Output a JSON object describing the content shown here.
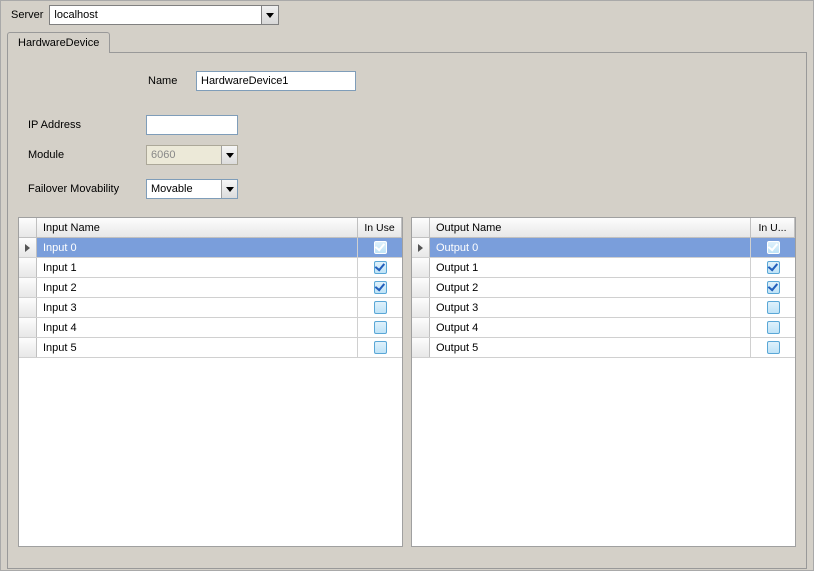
{
  "server": {
    "label": "Server",
    "value": "localhost"
  },
  "tab": {
    "label": "HardwareDevice"
  },
  "form": {
    "name_label": "Name",
    "name_value": "HardwareDevice1",
    "ip_label": "IP Address",
    "ip_value": "",
    "module_label": "Module",
    "module_value": "6060",
    "failover_label": "Failover Movability",
    "failover_value": "Movable"
  },
  "inputs": {
    "header_name": "Input Name",
    "header_inuse": "In Use",
    "rows": [
      {
        "name": "Input 0",
        "inuse": true,
        "selected": true
      },
      {
        "name": "Input 1",
        "inuse": true,
        "selected": false
      },
      {
        "name": "Input 2",
        "inuse": true,
        "selected": false
      },
      {
        "name": "Input 3",
        "inuse": false,
        "selected": false
      },
      {
        "name": "Input 4",
        "inuse": false,
        "selected": false
      },
      {
        "name": "Input 5",
        "inuse": false,
        "selected": false
      }
    ]
  },
  "outputs": {
    "header_name": "Output Name",
    "header_inuse": "In U...",
    "rows": [
      {
        "name": "Output 0",
        "inuse": true,
        "selected": true
      },
      {
        "name": "Output 1",
        "inuse": true,
        "selected": false
      },
      {
        "name": "Output 2",
        "inuse": true,
        "selected": false
      },
      {
        "name": "Output 3",
        "inuse": false,
        "selected": false
      },
      {
        "name": "Output 4",
        "inuse": false,
        "selected": false
      },
      {
        "name": "Output 5",
        "inuse": false,
        "selected": false
      }
    ]
  }
}
